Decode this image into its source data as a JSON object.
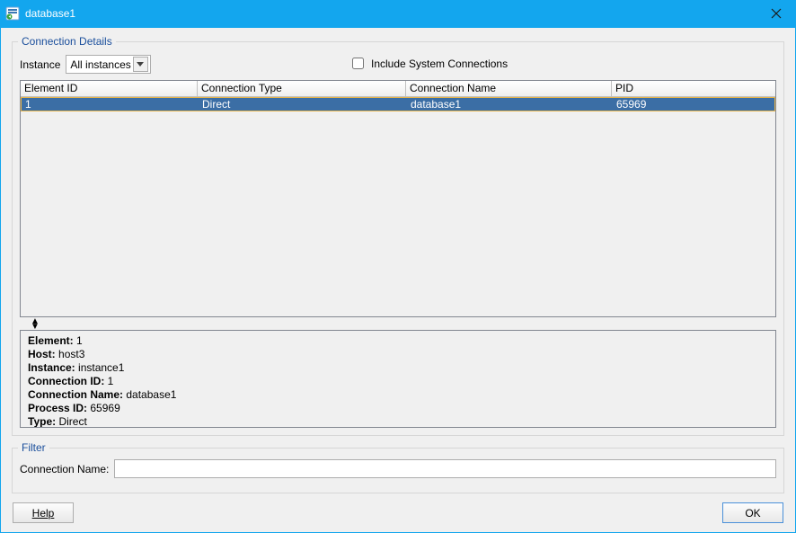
{
  "window": {
    "title": "database1"
  },
  "groups": {
    "connection_details": "Connection Details",
    "filter": "Filter"
  },
  "instance": {
    "label": "Instance",
    "selected": "All instances"
  },
  "include_system": {
    "label": "Include System Connections",
    "checked": false
  },
  "table": {
    "columns": {
      "element_id": "Element ID",
      "connection_type": "Connection Type",
      "connection_name": "Connection Name",
      "pid": "PID"
    },
    "rows": [
      {
        "element_id": "1",
        "connection_type": "Direct",
        "connection_name": "database1",
        "pid": "65969"
      }
    ]
  },
  "details": {
    "labels": {
      "element": "Element:",
      "host": "Host:",
      "instance": "Instance:",
      "connection_id": "Connection ID:",
      "connection_name": "Connection Name:",
      "process_id": "Process ID:",
      "type": "Type:"
    },
    "values": {
      "element": "1",
      "host": "host3",
      "instance": "instance1",
      "connection_id": "1",
      "connection_name": "database1",
      "process_id": "65969",
      "type": "Direct"
    }
  },
  "filter": {
    "connection_name_label": "Connection Name:",
    "connection_name_value": ""
  },
  "buttons": {
    "help": "Help",
    "ok": "OK"
  }
}
